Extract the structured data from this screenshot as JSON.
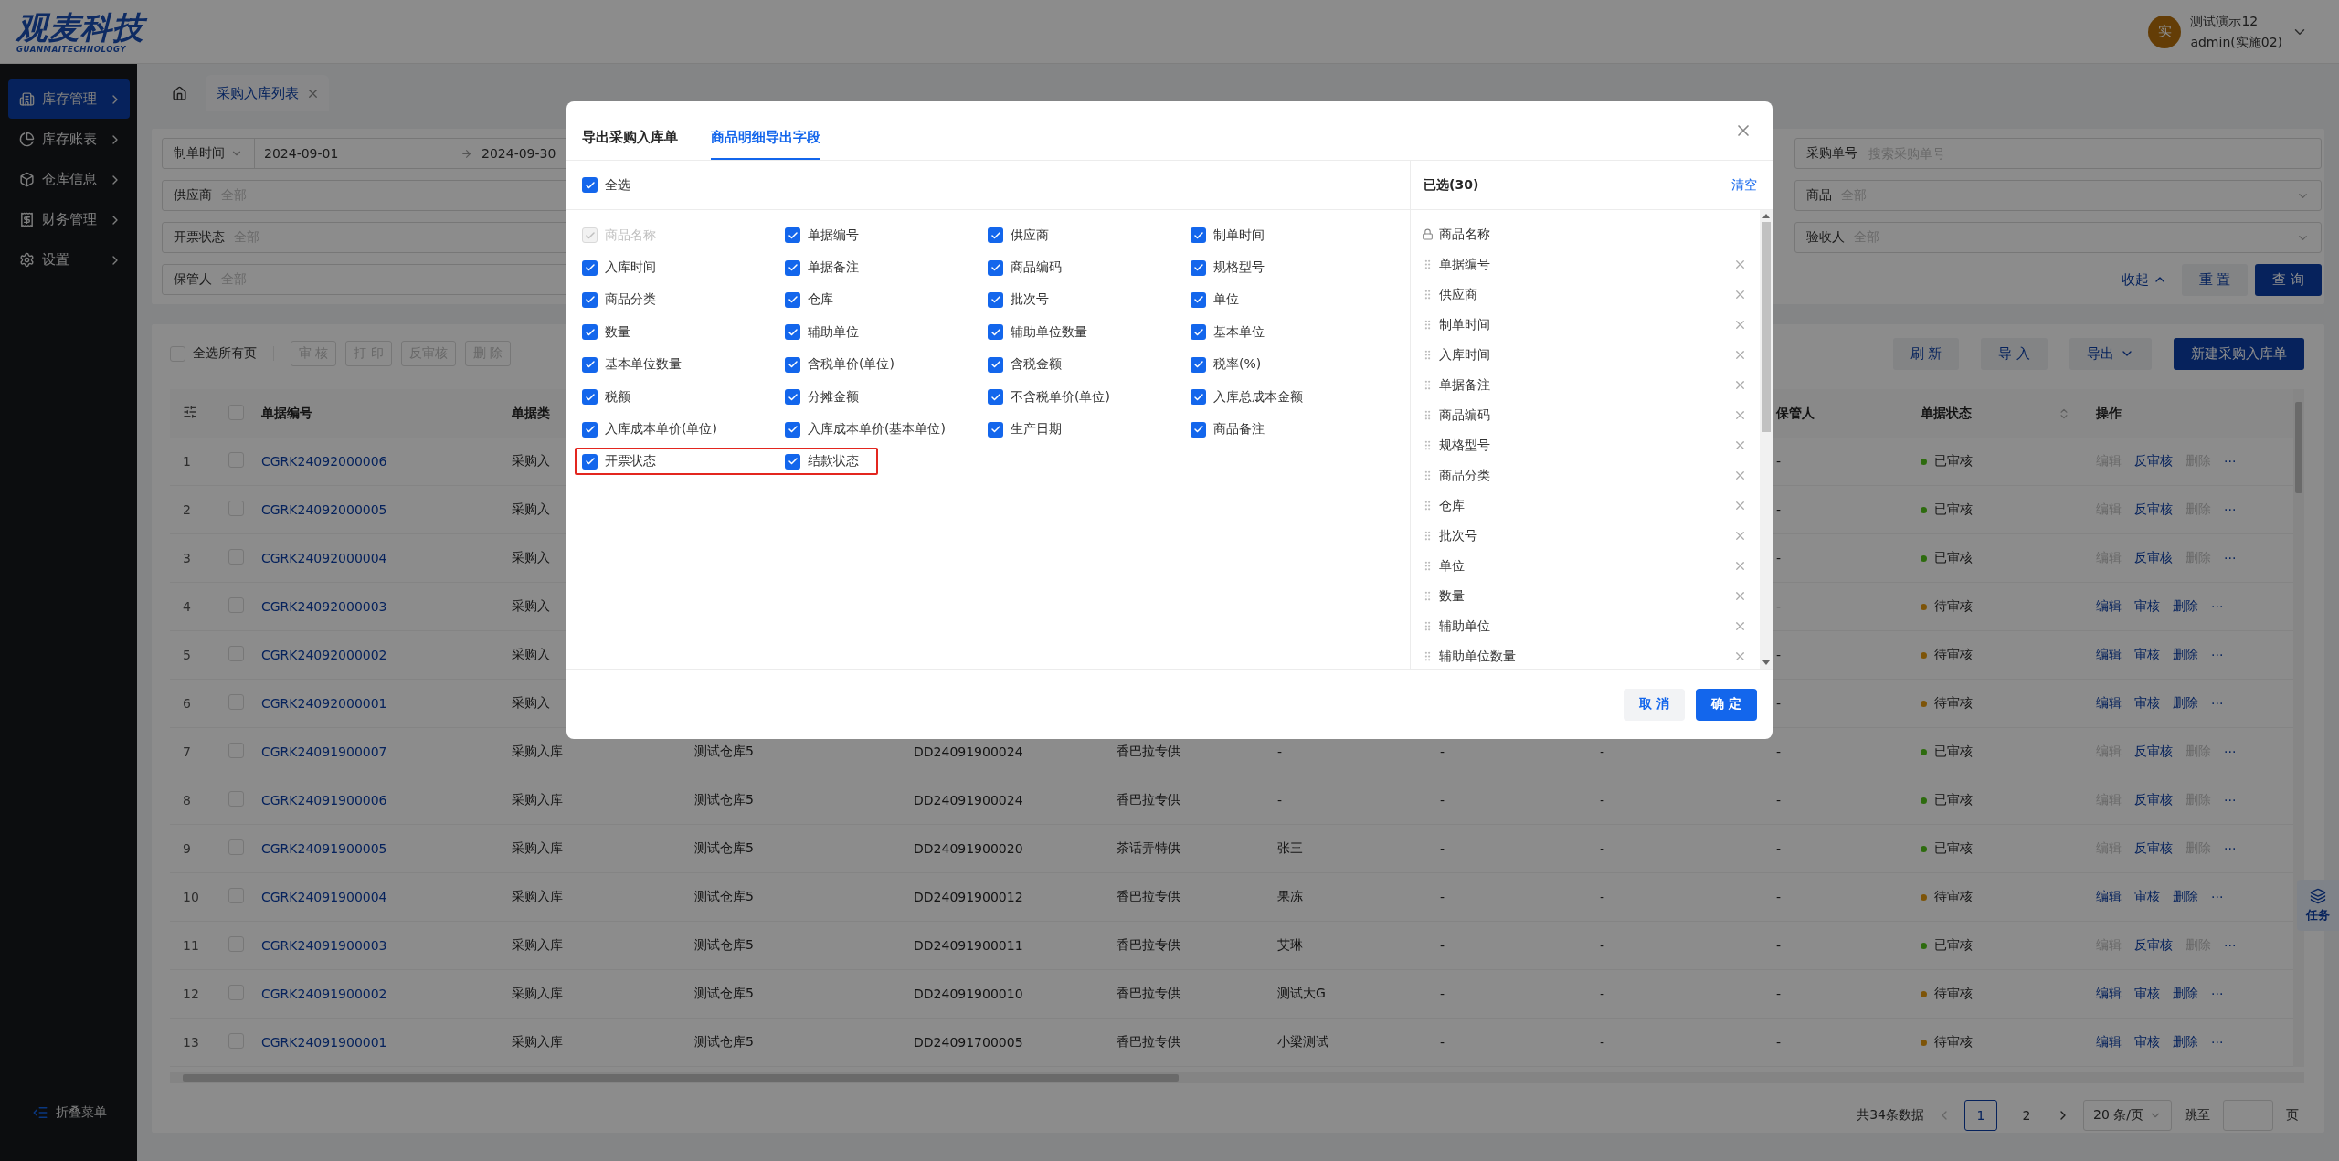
{
  "logo": {
    "name": "观麦科技",
    "tagline": "GUANMAITECHNOLOGY"
  },
  "user": {
    "avatar": "实",
    "name": "测试演示12",
    "role": "admin(实施02)"
  },
  "sidebar": {
    "items": [
      {
        "label": "库存管理",
        "selected": true
      },
      {
        "label": "库存账表",
        "selected": false
      },
      {
        "label": "仓库信息",
        "selected": false
      },
      {
        "label": "财务管理",
        "selected": false
      },
      {
        "label": "设置",
        "selected": false
      }
    ],
    "collapse": "折叠菜单"
  },
  "page_tabs": [
    {
      "label": "采购入库列表",
      "selected": true
    }
  ],
  "filters": {
    "left": [
      {
        "kind": "date_range",
        "label": "制单时间",
        "start": "2024-09-01",
        "end": "2024-09-30"
      },
      {
        "kind": "text",
        "label": "供应商",
        "value": "全部"
      },
      {
        "kind": "text",
        "label": "开票状态",
        "value": "全部"
      },
      {
        "kind": "text",
        "label": "保管人",
        "value": "全部"
      }
    ],
    "right": [
      {
        "kind": "search",
        "label": "采购单号",
        "placeholder": "搜索采购单号"
      },
      {
        "kind": "select",
        "label": "商品",
        "value": "全部"
      },
      {
        "kind": "select",
        "label": "验收人",
        "value": "全部"
      }
    ],
    "collapse": "收起",
    "reset": "重 置",
    "query": "查 询"
  },
  "toolbar": {
    "select_all": {
      "label": "全选所有页",
      "checked": false
    },
    "batch": [
      "审 核",
      "打 印",
      "反审核",
      "删 除"
    ],
    "right": [
      {
        "label": "刷 新",
        "kind": "plain"
      },
      {
        "label": "导 入",
        "kind": "plain"
      },
      {
        "label": "导出",
        "kind": "dropdown"
      },
      {
        "label": "新建采购入库单",
        "kind": "primary"
      }
    ]
  },
  "table": {
    "header_checkbox": {
      "checked": false
    },
    "columns": [
      "单据编号",
      "单据类",
      "保管人",
      "单据状态",
      "操作"
    ],
    "rows": [
      {
        "index": "1",
        "checked": false,
        "code": "CGRK24092000006",
        "type": "采购入",
        "keeper": "-",
        "status": {
          "label": "已审核",
          "kind": "approved"
        },
        "actions": [
          {
            "label": "编辑",
            "disabled": true
          },
          {
            "label": "反审核",
            "disabled": false
          },
          {
            "label": "删除",
            "disabled": true
          }
        ],
        "more": "···"
      },
      {
        "index": "2",
        "checked": false,
        "code": "CGRK24092000005",
        "type": "采购入",
        "keeper": "-",
        "status": {
          "label": "已审核",
          "kind": "approved"
        },
        "actions": [
          {
            "label": "编辑",
            "disabled": true
          },
          {
            "label": "反审核",
            "disabled": false
          },
          {
            "label": "删除",
            "disabled": true
          }
        ],
        "more": "···"
      },
      {
        "index": "3",
        "checked": false,
        "code": "CGRK24092000004",
        "type": "采购入",
        "keeper": "-",
        "status": {
          "label": "已审核",
          "kind": "approved"
        },
        "actions": [
          {
            "label": "编辑",
            "disabled": true
          },
          {
            "label": "反审核",
            "disabled": false
          },
          {
            "label": "删除",
            "disabled": true
          }
        ],
        "more": "···"
      },
      {
        "index": "4",
        "checked": false,
        "code": "CGRK24092000003",
        "type": "采购入",
        "keeper": "-",
        "status": {
          "label": "待审核",
          "kind": "pending"
        },
        "actions": [
          {
            "label": "编辑",
            "disabled": false
          },
          {
            "label": "审核",
            "disabled": false
          },
          {
            "label": "删除",
            "disabled": false
          }
        ],
        "more": "···"
      },
      {
        "index": "5",
        "checked": false,
        "code": "CGRK24092000002",
        "type": "采购入",
        "keeper": "-",
        "status": {
          "label": "待审核",
          "kind": "pending"
        },
        "actions": [
          {
            "label": "编辑",
            "disabled": false
          },
          {
            "label": "审核",
            "disabled": false
          },
          {
            "label": "删除",
            "disabled": false
          }
        ],
        "more": "···"
      },
      {
        "index": "6",
        "checked": false,
        "code": "CGRK24092000001",
        "type": "采购入",
        "keeper": "-",
        "status": {
          "label": "待审核",
          "kind": "pending"
        },
        "actions": [
          {
            "label": "编辑",
            "disabled": false
          },
          {
            "label": "审核",
            "disabled": false
          },
          {
            "label": "删除",
            "disabled": false
          }
        ],
        "more": "···"
      },
      {
        "index": "7",
        "checked": false,
        "code": "CGRK24091900007",
        "type": "采购入库",
        "warehouse": "测试仓库5",
        "order_no": "DD24091900024",
        "supplier": "香巴拉专供",
        "column_7": "-",
        "column_8": "-",
        "column_9": "-",
        "keeper": "-",
        "status": {
          "label": "已审核",
          "kind": "approved"
        },
        "actions": [
          {
            "label": "编辑",
            "disabled": true
          },
          {
            "label": "反审核",
            "disabled": false
          },
          {
            "label": "删除",
            "disabled": true
          }
        ],
        "more": "···"
      },
      {
        "index": "8",
        "checked": false,
        "code": "CGRK24091900006",
        "type": "采购入库",
        "warehouse": "测试仓库5",
        "order_no": "DD24091900024",
        "supplier": "香巴拉专供",
        "column_7": "-",
        "column_8": "-",
        "column_9": "-",
        "keeper": "-",
        "status": {
          "label": "已审核",
          "kind": "approved"
        },
        "actions": [
          {
            "label": "编辑",
            "disabled": true
          },
          {
            "label": "反审核",
            "disabled": false
          },
          {
            "label": "删除",
            "disabled": true
          }
        ],
        "more": "···"
      },
      {
        "index": "9",
        "checked": false,
        "code": "CGRK24091900005",
        "type": "采购入库",
        "warehouse": "测试仓库5",
        "order_no": "DD24091900020",
        "supplier": "茶话弄特供",
        "column_7": "张三",
        "column_8": "-",
        "column_9": "-",
        "keeper": "-",
        "status": {
          "label": "已审核",
          "kind": "approved"
        },
        "actions": [
          {
            "label": "编辑",
            "disabled": true
          },
          {
            "label": "反审核",
            "disabled": false
          },
          {
            "label": "删除",
            "disabled": true
          }
        ],
        "more": "···"
      },
      {
        "index": "10",
        "checked": false,
        "code": "CGRK24091900004",
        "type": "采购入库",
        "warehouse": "测试仓库5",
        "order_no": "DD24091900012",
        "supplier": "香巴拉专供",
        "column_7": "果冻",
        "column_8": "-",
        "column_9": "-",
        "keeper": "-",
        "status": {
          "label": "待审核",
          "kind": "pending"
        },
        "actions": [
          {
            "label": "编辑",
            "disabled": false
          },
          {
            "label": "审核",
            "disabled": false
          },
          {
            "label": "删除",
            "disabled": false
          }
        ],
        "more": "···"
      },
      {
        "index": "11",
        "checked": false,
        "code": "CGRK24091900003",
        "type": "采购入库",
        "warehouse": "测试仓库5",
        "order_no": "DD24091900011",
        "supplier": "香巴拉专供",
        "column_7": "艾琳",
        "column_8": "-",
        "column_9": "-",
        "keeper": "-",
        "status": {
          "label": "已审核",
          "kind": "approved"
        },
        "actions": [
          {
            "label": "编辑",
            "disabled": true
          },
          {
            "label": "反审核",
            "disabled": false
          },
          {
            "label": "删除",
            "disabled": true
          }
        ],
        "more": "···"
      },
      {
        "index": "12",
        "checked": false,
        "code": "CGRK24091900002",
        "type": "采购入库",
        "warehouse": "测试仓库5",
        "order_no": "DD24091900010",
        "supplier": "香巴拉专供",
        "column_7": "测试大G",
        "column_8": "-",
        "column_9": "-",
        "keeper": "-",
        "status": {
          "label": "待审核",
          "kind": "pending"
        },
        "actions": [
          {
            "label": "编辑",
            "disabled": false
          },
          {
            "label": "审核",
            "disabled": false
          },
          {
            "label": "删除",
            "disabled": false
          }
        ],
        "more": "···"
      },
      {
        "index": "13",
        "checked": false,
        "code": "CGRK24091900001",
        "type": "采购入库",
        "warehouse": "测试仓库5",
        "order_no": "DD24091700005",
        "supplier": "香巴拉专供",
        "column_7": "小梁测试",
        "column_8": "-",
        "column_9": "-",
        "keeper": "-",
        "status": {
          "label": "待审核",
          "kind": "pending"
        },
        "actions": [
          {
            "label": "编辑",
            "disabled": false
          },
          {
            "label": "审核",
            "disabled": false
          },
          {
            "label": "删除",
            "disabled": false
          }
        ],
        "more": "···"
      }
    ]
  },
  "pagination": {
    "total": "共34条数据",
    "pages": [
      {
        "label": "1",
        "selected": true
      },
      {
        "label": "2",
        "selected": false
      }
    ],
    "page_size": "20 条/页",
    "jump": "跳至",
    "suffix": "页"
  },
  "task_button": "任务",
  "modal": {
    "tabs": [
      {
        "label": "导出采购入库单",
        "selected": false
      },
      {
        "label": "商品明细导出字段",
        "selected": true
      }
    ],
    "select_all": {
      "label": "全选",
      "checked": true
    },
    "fields": [
      {
        "label": "商品名称",
        "checked": true,
        "disabled": true,
        "highlighted": false
      },
      {
        "label": "单据编号",
        "checked": true,
        "disabled": false,
        "highlighted": false
      },
      {
        "label": "供应商",
        "checked": true,
        "disabled": false,
        "highlighted": false
      },
      {
        "label": "制单时间",
        "checked": true,
        "disabled": false,
        "highlighted": false
      },
      {
        "label": "入库时间",
        "checked": true,
        "disabled": false,
        "highlighted": false
      },
      {
        "label": "单据备注",
        "checked": true,
        "disabled": false,
        "highlighted": false
      },
      {
        "label": "商品编码",
        "checked": true,
        "disabled": false,
        "highlighted": false
      },
      {
        "label": "规格型号",
        "checked": true,
        "disabled": false,
        "highlighted": false
      },
      {
        "label": "商品分类",
        "checked": true,
        "disabled": false,
        "highlighted": false
      },
      {
        "label": "仓库",
        "checked": true,
        "disabled": false,
        "highlighted": false
      },
      {
        "label": "批次号",
        "checked": true,
        "disabled": false,
        "highlighted": false
      },
      {
        "label": "单位",
        "checked": true,
        "disabled": false,
        "highlighted": false
      },
      {
        "label": "数量",
        "checked": true,
        "disabled": false,
        "highlighted": false
      },
      {
        "label": "辅助单位",
        "checked": true,
        "disabled": false,
        "highlighted": false
      },
      {
        "label": "辅助单位数量",
        "checked": true,
        "disabled": false,
        "highlighted": false
      },
      {
        "label": "基本单位",
        "checked": true,
        "disabled": false,
        "highlighted": false
      },
      {
        "label": "基本单位数量",
        "checked": true,
        "disabled": false,
        "highlighted": false
      },
      {
        "label": "含税单价(单位)",
        "checked": true,
        "disabled": false,
        "highlighted": false
      },
      {
        "label": "含税金额",
        "checked": true,
        "disabled": false,
        "highlighted": false
      },
      {
        "label": "税率(%)",
        "checked": true,
        "disabled": false,
        "highlighted": false
      },
      {
        "label": "税额",
        "checked": true,
        "disabled": false,
        "highlighted": false
      },
      {
        "label": "分摊金额",
        "checked": true,
        "disabled": false,
        "highlighted": false
      },
      {
        "label": "不含税单价(单位)",
        "checked": true,
        "disabled": false,
        "highlighted": false
      },
      {
        "label": "入库总成本金额",
        "checked": true,
        "disabled": false,
        "highlighted": false
      },
      {
        "label": "入库成本单价(单位)",
        "checked": true,
        "disabled": false,
        "highlighted": false
      },
      {
        "label": "入库成本单价(基本单位)",
        "checked": true,
        "disabled": false,
        "highlighted": false
      },
      {
        "label": "生产日期",
        "checked": true,
        "disabled": false,
        "highlighted": false
      },
      {
        "label": "商品备注",
        "checked": true,
        "disabled": false,
        "highlighted": false
      },
      {
        "label": "开票状态",
        "checked": true,
        "disabled": false,
        "highlighted": true
      },
      {
        "label": "结款状态",
        "checked": true,
        "disabled": false,
        "highlighted": true
      }
    ],
    "selected_title": "已选(30)",
    "clear": "清空",
    "selected": [
      {
        "label": "商品名称",
        "kind": "locked"
      },
      {
        "label": "单据编号",
        "kind": "removable"
      },
      {
        "label": "供应商",
        "kind": "removable"
      },
      {
        "label": "制单时间",
        "kind": "removable"
      },
      {
        "label": "入库时间",
        "kind": "removable"
      },
      {
        "label": "单据备注",
        "kind": "removable"
      },
      {
        "label": "商品编码",
        "kind": "removable"
      },
      {
        "label": "规格型号",
        "kind": "removable"
      },
      {
        "label": "商品分类",
        "kind": "removable"
      },
      {
        "label": "仓库",
        "kind": "removable"
      },
      {
        "label": "批次号",
        "kind": "removable"
      },
      {
        "label": "单位",
        "kind": "removable"
      },
      {
        "label": "数量",
        "kind": "removable"
      },
      {
        "label": "辅助单位",
        "kind": "removable"
      },
      {
        "label": "辅助单位数量",
        "kind": "removable"
      }
    ],
    "cancel": "取 消",
    "confirm": "确 定"
  }
}
